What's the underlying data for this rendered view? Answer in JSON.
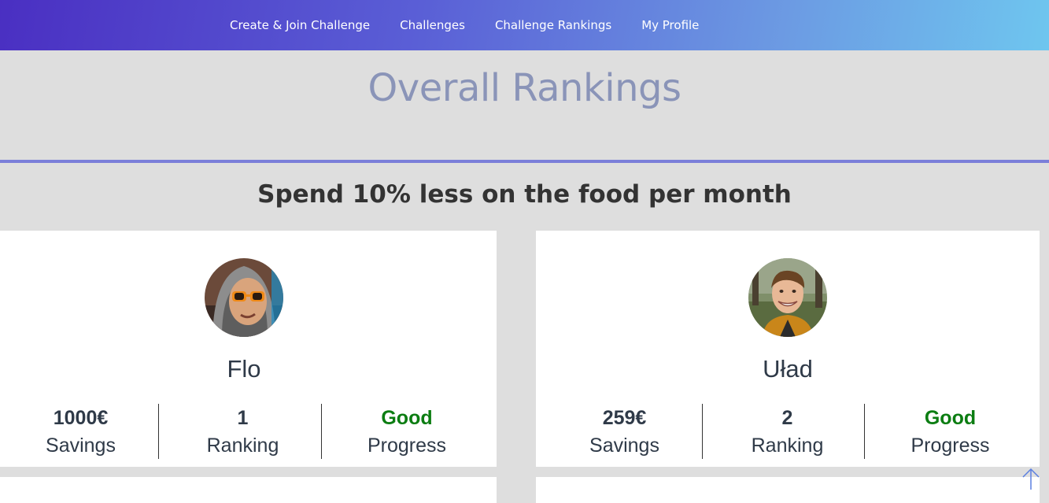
{
  "nav": {
    "items": [
      {
        "label": "Create & Join Challenge"
      },
      {
        "label": "Challenges"
      },
      {
        "label": "Challenge Rankings"
      },
      {
        "label": "My Profile"
      }
    ]
  },
  "page": {
    "title": "Overall Rankings"
  },
  "challenge": {
    "title": "Spend 10% less on the food per month"
  },
  "participants": [
    {
      "name": "Flo",
      "avatar_icon": "user-photo-sunglasses-hoodie",
      "savings_value": "1000€",
      "savings_label": "Savings",
      "ranking_value": "1",
      "ranking_label": "Ranking",
      "progress_value": "Good",
      "progress_label": "Progress"
    },
    {
      "name": "Uład",
      "avatar_icon": "user-photo-smiling",
      "savings_value": "259€",
      "savings_label": "Savings",
      "ranking_value": "2",
      "ranking_label": "Ranking",
      "progress_value": "Good",
      "progress_label": "Progress"
    }
  ],
  "colors": {
    "good": "#0c7d12",
    "divider": "#7b7fd9",
    "title": "#8a94b8"
  },
  "scroll_top_icon": "arrow-up-icon"
}
